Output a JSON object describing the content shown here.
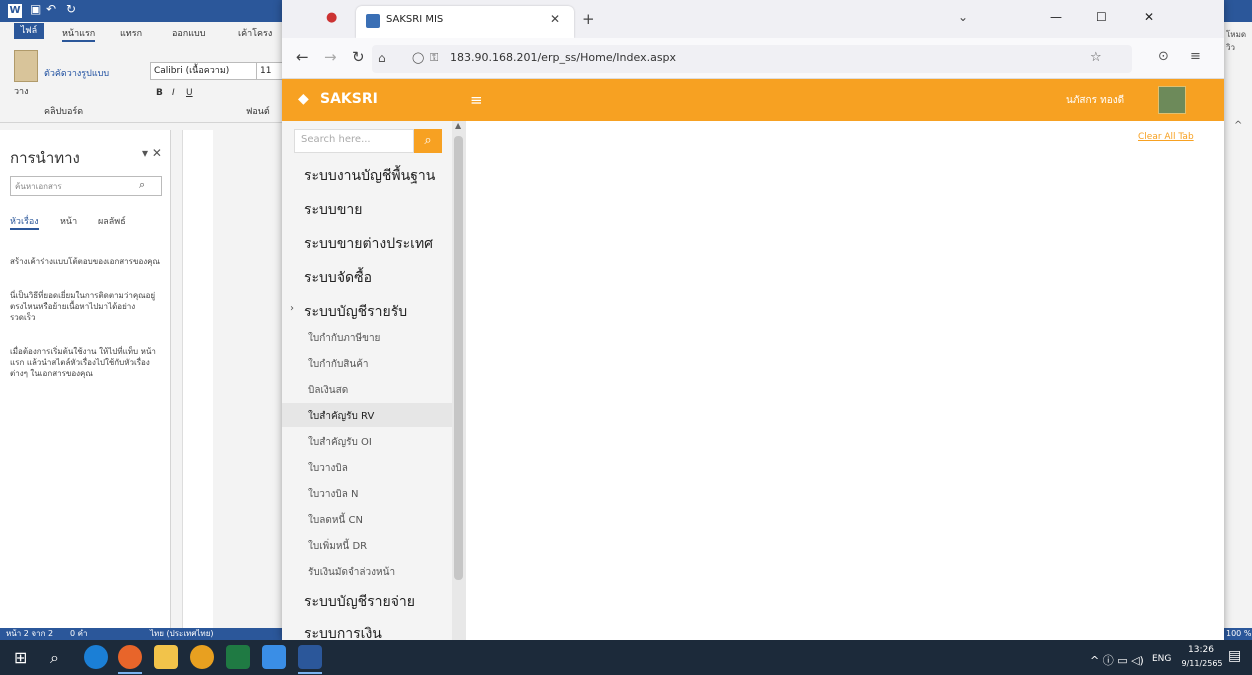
{
  "word": {
    "file_tab": "ไฟล์",
    "tabs": [
      "หน้าแรก",
      "แทรก",
      "ออกแบบ",
      "เค้าโครง"
    ],
    "font_name": "Calibri (เนื้อความ)",
    "font_size": "11",
    "clipboard_group": "คลิปบอร์ด",
    "font_group": "ฟอนต์",
    "paste_label": "วาง",
    "format_painter": "ตัวคัดวางรูปแบบ",
    "nav_title": "การนำทาง",
    "nav_search_placeholder": "ค้นหาเอกสาร",
    "nav_tabs": [
      "หัวเรื่อง",
      "หน้า",
      "ผลลัพธ์"
    ],
    "nav_text_1": "สร้างเค้าร่างแบบโต้ตอบของเอกสารของคุณ",
    "nav_text_2": "นี่เป็นวิธีที่ยอดเยี่ยมในการติดตามว่าคุณอยู่ตรงไหนหรือย้ายเนื้อหาไปมาได้อย่างรวดเร็ว",
    "nav_text_3": "เมื่อต้องการเริ่มต้นใช้งาน ให้ไปที่แท็บ หน้าแรก แล้วนำสไตล์หัวเรื่องไปใช้กับหัวเรื่องต่างๆ ในเอกสารของคุณ",
    "status_left": "หน้า 2 จาก 2",
    "status_words": "0 คำ",
    "status_lang": "ไทย (ประเทศไทย)",
    "status_zoom": "100 %",
    "right_label": "โหมดวิว"
  },
  "browser": {
    "tab_title": "SAKSRI MIS",
    "url": "183.90.168.201/erp_ss/Home/Index.aspx",
    "app_brand": "SAKSRI",
    "user_name": "นภัสกร ทองดี",
    "search_placeholder": "Search here...",
    "clear_all": "Clear All Tab",
    "menu": [
      {
        "label": "ระบบงานบัญชีพื้นฐาน"
      },
      {
        "label": "ระบบขาย"
      },
      {
        "label": "ระบบขายต่างประเทศ"
      },
      {
        "label": "ระบบจัดซื้อ"
      },
      {
        "label": "ระบบบัญชีรายรับ"
      }
    ],
    "submenu": [
      "ใบกำกับภาษีขาย",
      "ใบกำกับสินค้า",
      "บิลเงินสด",
      "ใบสำคัญรับ RV",
      "ใบสำคัญรับ OI",
      "ใบวางบิล",
      "ใบวางบิล N",
      "ใบลดหนี้ CN",
      "ใบเพิ่มหนี้ DR",
      "รับเงินมัดจำล่วงหน้า"
    ],
    "menu_after": [
      "ระบบบัญชีรายจ่าย",
      "ระบบการเงิน"
    ]
  },
  "taskbar": {
    "lang": "ENG",
    "time": "13:26",
    "date": "9/11/2565"
  }
}
